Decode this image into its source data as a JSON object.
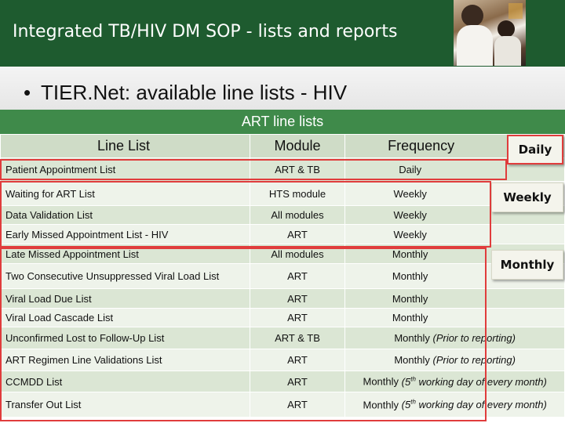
{
  "header": {
    "title": "Integrated TB/HIV DM SOP - lists and reports"
  },
  "bullet": {
    "symbol": "•",
    "text": "TIER.Net: available line lists - HIV"
  },
  "table": {
    "title": "ART line lists",
    "columns": [
      "Line List",
      "Module",
      "Frequency"
    ],
    "rows": [
      {
        "list": "Patient Appointment List",
        "module": "ART & TB",
        "frequency": "Daily",
        "note": ""
      },
      {
        "list": "Waiting for ART List",
        "module": "HTS module",
        "frequency": "Weekly",
        "note": ""
      },
      {
        "list": "Data Validation List",
        "module": "All modules",
        "frequency": "Weekly",
        "note": ""
      },
      {
        "list": "Early Missed Appointment List - HIV",
        "module": "ART",
        "frequency": "Weekly",
        "note": ""
      },
      {
        "list": "Late Missed Appointment List",
        "module": "All modules",
        "frequency": "Monthly",
        "note": ""
      },
      {
        "list": "Two Consecutive Unsuppressed  Viral Load List",
        "module": "ART",
        "frequency": "Monthly",
        "note": ""
      },
      {
        "list": "Viral Load Due List",
        "module": "ART",
        "frequency": "Monthly",
        "note": ""
      },
      {
        "list": "Viral Load Cascade List",
        "module": "ART",
        "frequency": "Monthly",
        "note": ""
      },
      {
        "list": "Unconfirmed Lost to Follow-Up List",
        "module": "ART & TB",
        "frequency": "Monthly",
        "note": "(Prior to reporting)"
      },
      {
        "list": "ART Regimen Line Validations List",
        "module": "ART",
        "frequency": "Monthly",
        "note": "(Prior to reporting)"
      },
      {
        "list": "CCMDD List",
        "module": "ART",
        "frequency": "Monthly",
        "note": "(5th working day of every month)"
      },
      {
        "list": "Transfer Out List",
        "module": "ART",
        "frequency": "Monthly",
        "note": "(5th working day of every month)"
      }
    ]
  },
  "callouts": {
    "daily": "Daily",
    "weekly": "Weekly",
    "monthly": "Monthly"
  },
  "colors": {
    "header_bg": "#1e5b2f",
    "table_title_bg": "#3f8a4a",
    "row_odd": "#dbe6d4",
    "row_even": "#eef3ea",
    "highlight": "#e03c3c"
  }
}
